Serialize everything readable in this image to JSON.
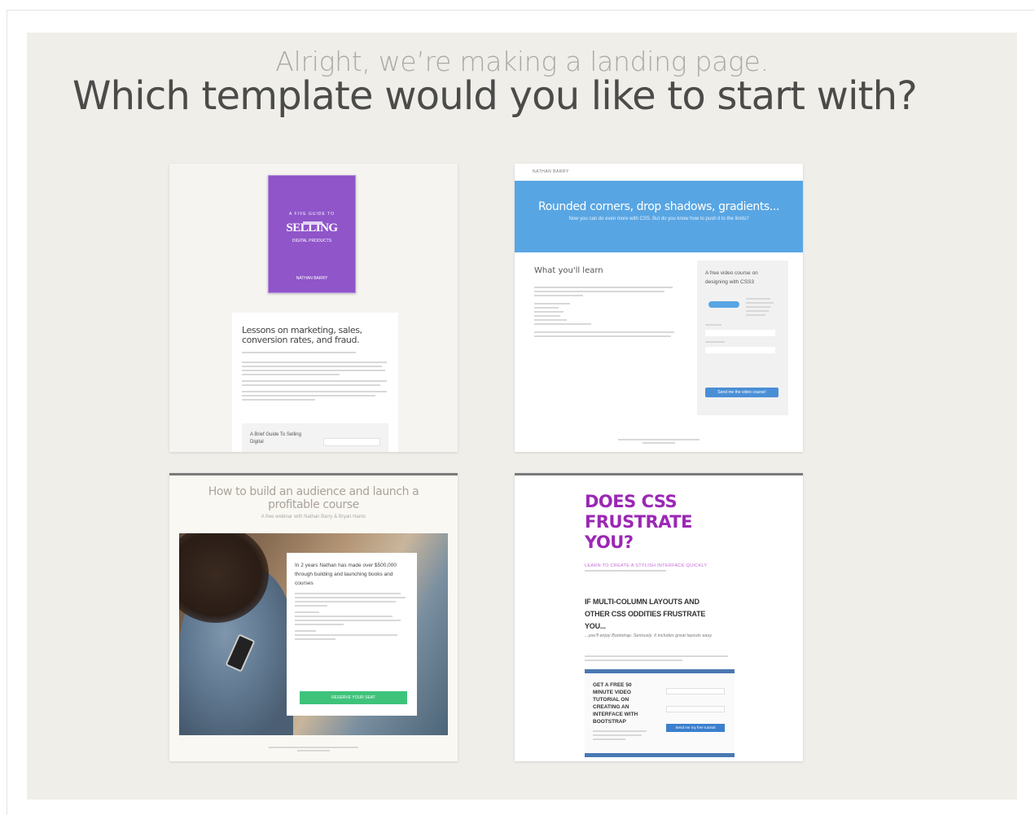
{
  "header": {
    "subtitle": "Alright, we’re making a landing page.",
    "title": "Which template would you like to start with?"
  },
  "templates": [
    {
      "book": {
        "top": "A FIVE GUIDE TO",
        "main": "SELLING",
        "sub": "DIGITAL PRODUCTS",
        "author": "NATHAN BARRY"
      },
      "headline": "Lessons on marketing, sales, conversion rates, and fraud.",
      "box_text": "A Brief Guide To Selling Digital"
    },
    {
      "brand": "NATHAN BARRY",
      "hero_title": "Rounded corners, drop shadows, gradients...",
      "hero_sub": "Now you can do even more with CSS. But do you know how to push it to the limits?",
      "section_title": "What you'll learn",
      "side_title": "A free video course on designing with CSS3",
      "button": "Send me the video course!"
    },
    {
      "headline": "How to build an audience and launch a profitable course",
      "subline": "A free webinar with Nathan Barry & Bryan Harris",
      "card_headline": "In 2 years Nathan has made over $500,000 through building and launching books and courses",
      "button": "RESERVE YOUR SEAT"
    },
    {
      "headline": "DOES CSS FRUSTRATE YOU?",
      "tagline": "LEARN TO CREATE A STYLISH INTERFACE QUICKLY",
      "caption": "IF MULTI-COLUMN LAYOUTS AND OTHER CSS ODDITIES FRUSTRATE YOU...",
      "italic": "...you'll enjoy Bootstrap. Seriously. It includes great layouts easy.",
      "optin_text": "GET A FREE 50 MINUTE VIDEO TUTORIAL ON CREATING AN INTERFACE WITH BOOTSTRAP",
      "button": "Send me my free tutorial"
    }
  ]
}
